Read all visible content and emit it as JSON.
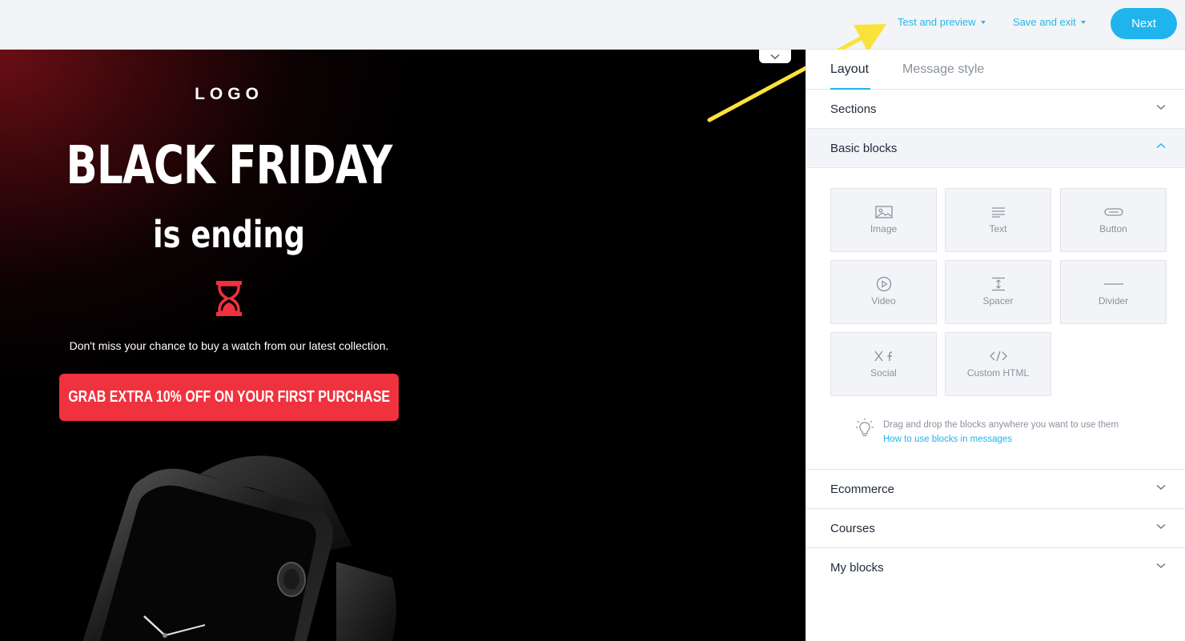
{
  "topbar": {
    "test_preview": "Test and preview",
    "save_exit": "Save and exit",
    "next": "Next"
  },
  "email": {
    "logo": "LOGO",
    "headline": "BLACK FRIDAY",
    "subheadline": "is ending",
    "description": "Don't miss your chance to buy a watch from our latest collection.",
    "cta": "GRAB EXTRA 10% OFF ON YOUR FIRST PURCHASE"
  },
  "panel": {
    "tabs": [
      "Layout",
      "Message style"
    ],
    "sections": [
      "Sections",
      "Basic blocks",
      "Ecommerce",
      "Courses",
      "My blocks"
    ],
    "blocks": [
      {
        "label": "Image",
        "icon": "image-icon"
      },
      {
        "label": "Text",
        "icon": "text-icon"
      },
      {
        "label": "Button",
        "icon": "button-icon"
      },
      {
        "label": "Video",
        "icon": "video-icon"
      },
      {
        "label": "Spacer",
        "icon": "spacer-icon"
      },
      {
        "label": "Divider",
        "icon": "divider-icon"
      },
      {
        "label": "Social",
        "icon": "social-icon"
      },
      {
        "label": "Custom HTML",
        "icon": "code-icon"
      }
    ],
    "hint": "Drag and drop the blocks anywhere you want to use them",
    "hint_link": "How to use blocks in messages"
  },
  "colors": {
    "accent": "#1fb4ee",
    "cta": "#f0313e",
    "annotation_arrow": "#fbe23a"
  }
}
